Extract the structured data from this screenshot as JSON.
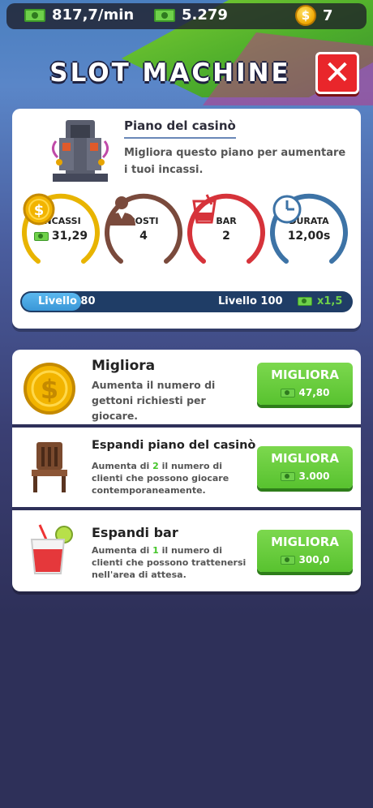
{
  "status": {
    "income_rate": "817,7/min",
    "cash": "5.279",
    "coins": "7"
  },
  "header": {
    "title": "SLOT MACHINE",
    "close_symbol": "✕"
  },
  "floor": {
    "title": "Piano del casinò",
    "description": "Migliora questo piano per aumentare i tuoi incassi.",
    "stats": [
      {
        "label": "INCASSI",
        "value": "31,29",
        "color": "#e8b400"
      },
      {
        "label": "POSTI",
        "value": "4",
        "color": "#7a4a3c"
      },
      {
        "label": "BAR",
        "value": "2",
        "color": "#d6333a"
      },
      {
        "label": "DURATA",
        "value": "12,00s",
        "color": "#3d73a6"
      }
    ],
    "level": {
      "current": "Livello 80",
      "target": "Livello 100",
      "multiplier": "x1,5",
      "progress": 0.18
    }
  },
  "upgrades": [
    {
      "title": "Migliora",
      "description": "Aumenta il numero di gettoni richiesti per giocare.",
      "button": "MIGLIORA",
      "price": "47,80",
      "icon": "dollar-coin-icon"
    },
    {
      "title": "Espandi piano del casinò",
      "desc_before": "Aumenta di ",
      "desc_num": "2",
      "desc_after": " il numero di clienti che possono giocare contemporaneamente.",
      "button": "MIGLIORA",
      "price": "3.000",
      "icon": "chair-icon"
    },
    {
      "title": "Espandi bar",
      "desc_before": "Aumenta di ",
      "desc_num": "1",
      "desc_after": " il numero di clienti che possono trattenersi nell'area di attesa.",
      "button": "MIGLIORA",
      "price": "300,0",
      "icon": "cocktail-icon"
    }
  ]
}
